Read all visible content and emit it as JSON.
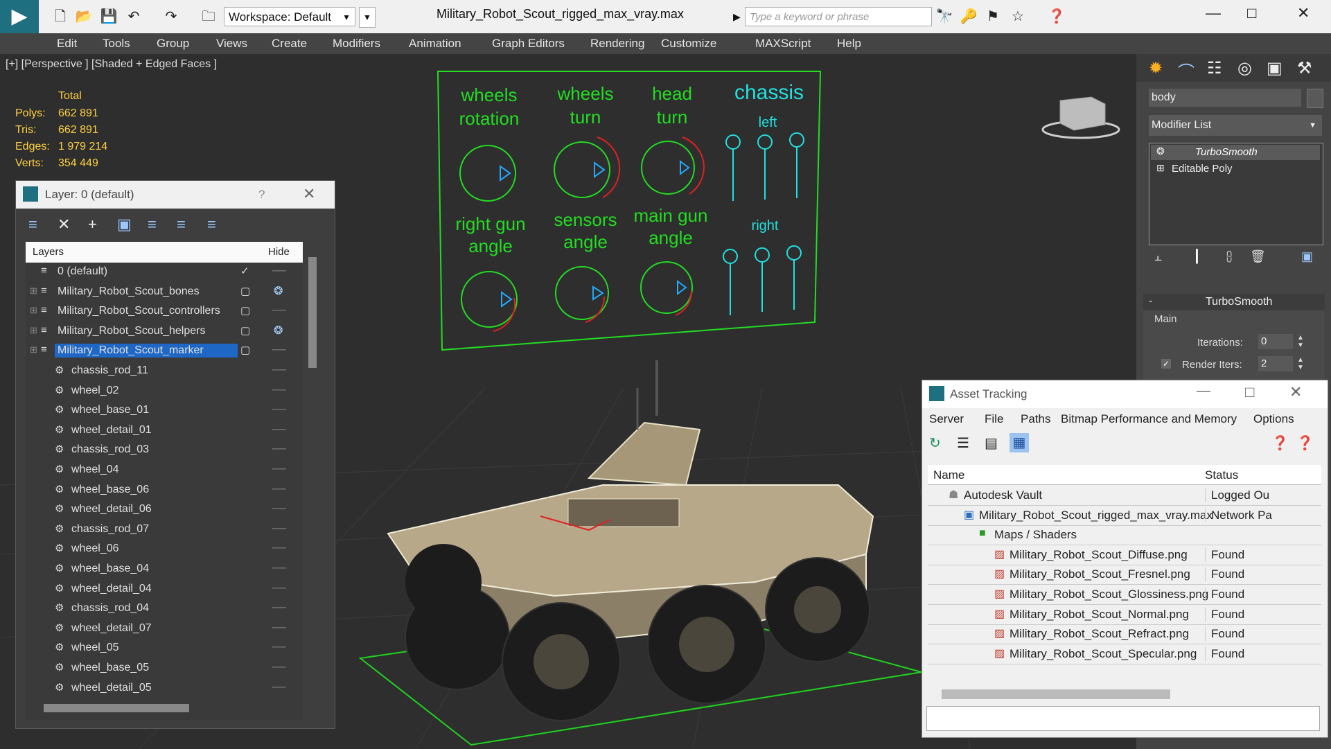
{
  "titlebar": {
    "workspace": "Workspace: Default",
    "doc_title": "Military_Robot_Scout_rigged_max_vray.max",
    "search_placeholder": "Type a keyword or phrase"
  },
  "menu": [
    "Edit",
    "Tools",
    "Group",
    "Views",
    "Create",
    "Modifiers",
    "Animation",
    "Graph Editors",
    "Rendering",
    "Customize",
    "MAXScript",
    "Help"
  ],
  "viewport": {
    "label": "[+] [Perspective ] [Shaded + Edged Faces ]",
    "stats_header": "Total",
    "stats": [
      {
        "label": "Polys:",
        "value": "662 891"
      },
      {
        "label": "Tris:",
        "value": "662 891"
      },
      {
        "label": "Edges:",
        "value": "1 979 214"
      },
      {
        "label": "Verts:",
        "value": "354 449"
      }
    ]
  },
  "control_board": {
    "labels": {
      "wheels_rotation": [
        "wheels",
        "rotation"
      ],
      "wheels_turn": [
        "wheels",
        "turn"
      ],
      "head_turn": [
        "head",
        "turn"
      ],
      "chassis": "chassis",
      "left": "left",
      "right": "right",
      "right_gun_angle": [
        "right gun",
        "angle"
      ],
      "sensors_angle": [
        "sensors",
        "angle"
      ],
      "main_gun_angle": [
        "main gun",
        "angle"
      ]
    }
  },
  "layer_panel": {
    "title": "Layer: 0 (default)",
    "help": "?",
    "col_layers": "Layers",
    "col_hide": "Hide",
    "rows": [
      {
        "name": "0 (default)",
        "type": "layer",
        "selected": false
      },
      {
        "name": "Military_Robot_Scout_bones",
        "type": "layer",
        "selected": false
      },
      {
        "name": "Military_Robot_Scout_controllers",
        "type": "layer",
        "selected": false
      },
      {
        "name": "Military_Robot_Scout_helpers",
        "type": "layer",
        "selected": false
      },
      {
        "name": "Military_Robot_Scout_marker",
        "type": "layer",
        "selected": true
      },
      {
        "name": "chassis_rod_11",
        "type": "object"
      },
      {
        "name": "wheel_02",
        "type": "object"
      },
      {
        "name": "wheel_base_01",
        "type": "object"
      },
      {
        "name": "wheel_detail_01",
        "type": "object"
      },
      {
        "name": "chassis_rod_03",
        "type": "object"
      },
      {
        "name": "wheel_04",
        "type": "object"
      },
      {
        "name": "wheel_base_06",
        "type": "object"
      },
      {
        "name": "wheel_detail_06",
        "type": "object"
      },
      {
        "name": "chassis_rod_07",
        "type": "object"
      },
      {
        "name": "wheel_06",
        "type": "object"
      },
      {
        "name": "wheel_base_04",
        "type": "object"
      },
      {
        "name": "wheel_detail_04",
        "type": "object"
      },
      {
        "name": "chassis_rod_04",
        "type": "object"
      },
      {
        "name": "wheel_detail_07",
        "type": "object"
      },
      {
        "name": "wheel_05",
        "type": "object"
      },
      {
        "name": "wheel_base_05",
        "type": "object"
      },
      {
        "name": "wheel_detail_05",
        "type": "object"
      }
    ]
  },
  "command_panel": {
    "object_name": "body",
    "modifier_list": "Modifier List",
    "stack": [
      "TurboSmooth",
      "Editable Poly"
    ],
    "rollout_title": "TurboSmooth",
    "group_main": "Main",
    "iterations_label": "Iterations:",
    "iterations_value": "0",
    "render_iters_label": "Render Iters:",
    "render_iters_value": "2"
  },
  "asset_tracking": {
    "title": "Asset Tracking",
    "menu": [
      "Server",
      "File",
      "Paths",
      "Bitmap Performance and Memory",
      "Options"
    ],
    "col_name": "Name",
    "col_status": "Status",
    "rows": [
      {
        "name": "Autodesk Vault",
        "status": "Logged Ou",
        "indent": 0,
        "icon": "vault-icon"
      },
      {
        "name": "Military_Robot_Scout_rigged_max_vray.max",
        "status": "Network Pa",
        "indent": 1,
        "icon": "max-file-icon"
      },
      {
        "name": "Maps / Shaders",
        "status": "",
        "indent": 2,
        "icon": "maps-icon"
      },
      {
        "name": "Military_Robot_Scout_Diffuse.png",
        "status": "Found",
        "indent": 3,
        "icon": "png-icon"
      },
      {
        "name": "Military_Robot_Scout_Fresnel.png",
        "status": "Found",
        "indent": 3,
        "icon": "png-icon"
      },
      {
        "name": "Military_Robot_Scout_Glossiness.png",
        "status": "Found",
        "indent": 3,
        "icon": "png-icon"
      },
      {
        "name": "Military_Robot_Scout_Normal.png",
        "status": "Found",
        "indent": 3,
        "icon": "png-icon"
      },
      {
        "name": "Military_Robot_Scout_Refract.png",
        "status": "Found",
        "indent": 3,
        "icon": "png-icon"
      },
      {
        "name": "Military_Robot_Scout_Specular.png",
        "status": "Found",
        "indent": 3,
        "icon": "png-icon"
      }
    ]
  }
}
